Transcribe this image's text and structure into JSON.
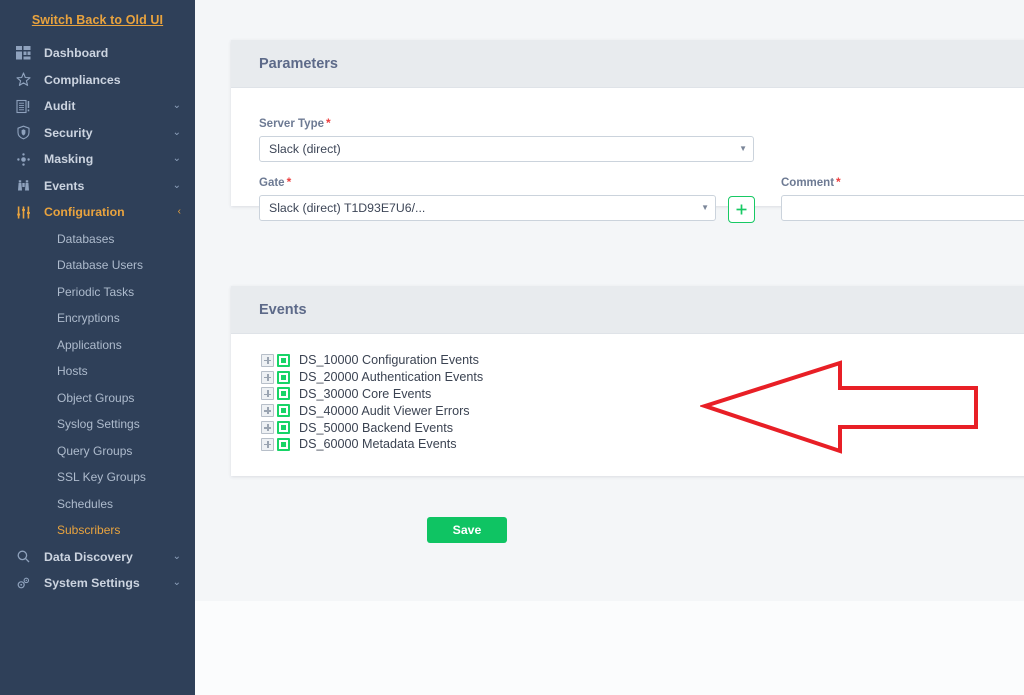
{
  "sidebar": {
    "switch_link": "Switch Back to Old UI",
    "items": [
      {
        "label": "Dashboard",
        "icon": "dashboard-grid-icon",
        "caret": "",
        "active": false
      },
      {
        "label": "Compliances",
        "icon": "star-icon",
        "caret": "",
        "active": false
      },
      {
        "label": "Audit",
        "icon": "audit-document-icon",
        "caret": "⌄",
        "active": false
      },
      {
        "label": "Security",
        "icon": "shield-icon",
        "caret": "⌄",
        "active": false
      },
      {
        "label": "Masking",
        "icon": "masking-dots-icon",
        "caret": "⌄",
        "active": false
      },
      {
        "label": "Events",
        "icon": "binoculars-icon",
        "caret": "⌄",
        "active": false
      },
      {
        "label": "Configuration",
        "icon": "sliders-icon",
        "caret": "‹",
        "active": true
      }
    ],
    "sub_items": [
      {
        "label": "Databases",
        "active": false
      },
      {
        "label": "Database Users",
        "active": false
      },
      {
        "label": "Periodic Tasks",
        "active": false
      },
      {
        "label": "Encryptions",
        "active": false
      },
      {
        "label": "Applications",
        "active": false
      },
      {
        "label": "Hosts",
        "active": false
      },
      {
        "label": "Object Groups",
        "active": false
      },
      {
        "label": "Syslog Settings",
        "active": false
      },
      {
        "label": "Query Groups",
        "active": false
      },
      {
        "label": "SSL Key Groups",
        "active": false
      },
      {
        "label": "Schedules",
        "active": false
      },
      {
        "label": "Subscribers",
        "active": true
      }
    ],
    "bottom_items": [
      {
        "label": "Data Discovery",
        "icon": "search-icon",
        "caret": "⌄"
      },
      {
        "label": "System Settings",
        "icon": "gears-icon",
        "caret": "⌄"
      }
    ],
    "colors": {
      "background": "#2f4059",
      "accent": "#e9a33e",
      "label": "#ccd4e0",
      "sub_label": "#aebbcd"
    }
  },
  "parameters_panel": {
    "title": "Parameters",
    "server_type": {
      "label": "Server Type",
      "required_marker": "*",
      "value": "Slack (direct)",
      "caret": "▼"
    },
    "gate": {
      "label": "Gate",
      "required_marker": "*",
      "value": "Slack (direct) T1D93E7U6/...",
      "caret": "▼"
    },
    "add_gate_button": {
      "icon": "plus-icon",
      "label": "+"
    },
    "comment": {
      "label": "Comment",
      "required_marker": "*",
      "value": "",
      "placeholder": ""
    }
  },
  "events_panel": {
    "title": "Events",
    "tree_items": [
      {
        "code": "DS_10000",
        "name": "Configuration Events",
        "label": "DS_10000 Configuration Events",
        "checked": true,
        "expanded": false
      },
      {
        "code": "DS_20000",
        "name": "Authentication Events",
        "label": "DS_20000 Authentication Events",
        "checked": true,
        "expanded": false
      },
      {
        "code": "DS_30000",
        "name": "Core Events",
        "label": "DS_30000 Core Events",
        "checked": true,
        "expanded": false
      },
      {
        "code": "DS_40000",
        "name": "Audit Viewer Errors",
        "label": "DS_40000 Audit Viewer Errors",
        "checked": true,
        "expanded": false
      },
      {
        "code": "DS_50000",
        "name": "Backend Events",
        "label": "DS_50000 Backend Events",
        "checked": true,
        "expanded": false
      },
      {
        "code": "DS_60000",
        "name": "Metadata Events",
        "label": "DS_60000 Metadata Events",
        "checked": true,
        "expanded": false
      }
    ]
  },
  "actions": {
    "save_label": "Save",
    "save_color": "#0fc463"
  },
  "annotation": {
    "type": "arrow",
    "direction": "left",
    "color": "#e81f26",
    "points_at": "events-tree"
  }
}
